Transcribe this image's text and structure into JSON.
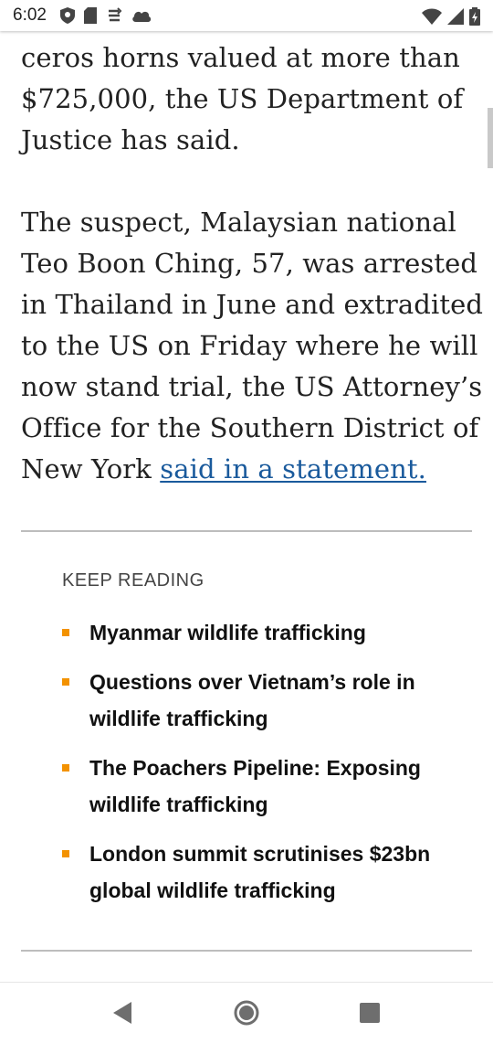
{
  "status_bar": {
    "time": "6:02",
    "left_icons": [
      "shield-icon",
      "sd-card-icon",
      "sync-icon",
      "cloud-icon"
    ],
    "right_icons": [
      "wifi-icon",
      "cellular-signal-icon",
      "battery-icon"
    ]
  },
  "article": {
    "para1_lines": [
      "ceros horns valued at more than",
      "$725,000, the US Department of",
      "Justice has said."
    ],
    "para2_lines": [
      "The suspect, Malaysian national",
      "Teo Boon Ching, 57, was arrested",
      "in Thailand in June and extradited",
      "to the US on Friday where he will",
      "now stand trial, the US Attorney’s",
      "Office for the Southern District of"
    ],
    "para2_last_text": "New York ",
    "para2_link": "said in a statement."
  },
  "keep_reading": {
    "heading": "KEEP READING",
    "items": [
      {
        "lines": [
          "Myanmar wildlife trafficking"
        ]
      },
      {
        "lines": [
          "Questions over Vietnam’s role in",
          "wildlife trafficking"
        ]
      },
      {
        "lines": [
          "The Poachers Pipeline: Exposing",
          "wildlife trafficking"
        ]
      },
      {
        "lines": [
          "London summit scrutinises $23bn",
          "global wildlife trafficking"
        ]
      }
    ],
    "bullet_color": "#f39200"
  },
  "colors": {
    "link": "#1a5a9c",
    "text": "#222222",
    "divider": "#bdbdbd"
  },
  "nav_bar": {
    "buttons": [
      "back-icon",
      "home-icon",
      "recents-icon"
    ]
  }
}
